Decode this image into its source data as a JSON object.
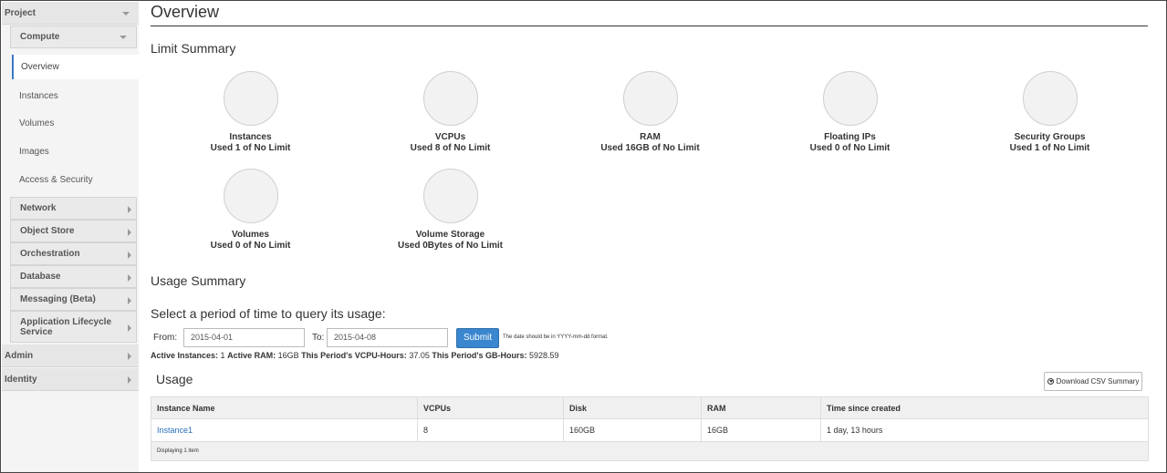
{
  "sidebar": {
    "project": "Project",
    "compute": "Compute",
    "items": [
      "Overview",
      "Instances",
      "Volumes",
      "Images",
      "Access & Security"
    ],
    "groups": [
      "Network",
      "Object Store",
      "Orchestration",
      "Database",
      "Messaging (Beta)",
      "Application Lifecycle Service"
    ],
    "admin": "Admin",
    "identity": "Identity"
  },
  "page": {
    "title": "Overview",
    "limit_summary": "Limit Summary",
    "usage_summary": "Usage Summary"
  },
  "limits": [
    {
      "name": "Instances",
      "used": "Used 1 of No Limit"
    },
    {
      "name": "VCPUs",
      "used": "Used 8 of No Limit"
    },
    {
      "name": "RAM",
      "used": "Used 16GB of No Limit"
    },
    {
      "name": "Floating IPs",
      "used": "Used 0 of No Limit"
    },
    {
      "name": "Security Groups",
      "used": "Used 1 of No Limit"
    },
    {
      "name": "Volumes",
      "used": "Used 0 of No Limit"
    },
    {
      "name": "Volume Storage",
      "used": "Used 0Bytes of No Limit"
    }
  ],
  "query": {
    "title": "Select a period of time to query its usage:",
    "from_label": "From:",
    "from_value": "2015-04-01",
    "to_label": "To:",
    "to_value": "2015-04-08",
    "submit": "Submit",
    "note": "The date should be in YYYY-mm-dd format."
  },
  "stats": {
    "active_instances_label": "Active Instances:",
    "active_instances": "1",
    "active_ram_label": "Active RAM:",
    "active_ram": "16GB",
    "vcpu_hours_label": "This Period's VCPU-Hours:",
    "vcpu_hours": "37.05",
    "gb_hours_label": "This Period's GB-Hours:",
    "gb_hours": "5928.59"
  },
  "usage": {
    "title": "Usage",
    "csv_button": "Download CSV Summary",
    "columns": [
      "Instance Name",
      "VCPUs",
      "Disk",
      "RAM",
      "Time since created"
    ],
    "rows": [
      [
        "Instance1",
        "8",
        "160GB",
        "16GB",
        "1 day, 13 hours"
      ]
    ],
    "footer": "Displaying 1 item"
  }
}
